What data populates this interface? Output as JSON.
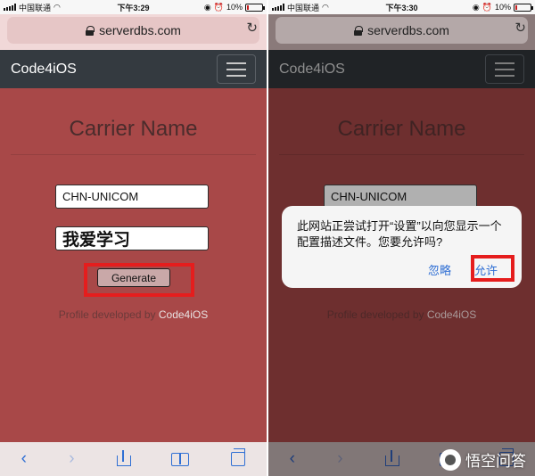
{
  "left": {
    "status": {
      "carrier": "中国联通",
      "time": "下午3:29",
      "battery": "10%",
      "battery_level": 0.1
    },
    "browser": {
      "url": "serverdbs.com"
    },
    "app": {
      "brand": "Code4iOS",
      "title": "Carrier Name",
      "carrier_value": "CHN-UNICOM",
      "custom_value": "我爱学习",
      "generate_label": "Generate",
      "profile_prefix": "Profile developed by",
      "profile_link": "Code4iOS"
    }
  },
  "right": {
    "status": {
      "carrier": "中国联通",
      "time": "下午3:30",
      "battery": "10%",
      "battery_level": 0.1
    },
    "browser": {
      "url": "serverdbs.com"
    },
    "app": {
      "brand": "Code4iOS",
      "title": "Carrier Name",
      "carrier_value": "CHN-UNICOM",
      "profile_prefix": "Profile developed by",
      "profile_link": "Code4iOS"
    },
    "dialog": {
      "message": "此网站正尝试打开“设置”以向您显示一个配置描述文件。您要允许吗?",
      "ignore_label": "忽略",
      "allow_label": "允许"
    }
  },
  "watermark": {
    "text": "悟空问答"
  },
  "colors": {
    "content_bg": "#a84848",
    "navbar_bg": "#343a40",
    "highlight": "#e51d1d",
    "link_blue": "#2f6fd4"
  }
}
